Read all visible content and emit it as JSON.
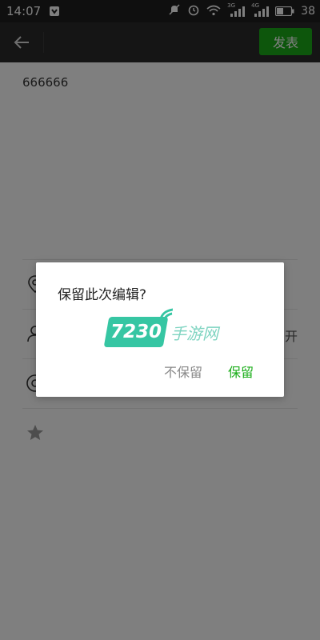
{
  "status_bar": {
    "time": "14:07",
    "network_3g": "3G",
    "network_4g": "4G",
    "battery_level": "38"
  },
  "header": {
    "publish_label": "发表"
  },
  "post": {
    "text": "666666"
  },
  "list": {
    "row_2_trailing": "开"
  },
  "dialog": {
    "title": "保留此次编辑?",
    "discard_label": "不保留",
    "keep_label": "保留"
  },
  "watermark": {
    "number": "7230",
    "text": "手游网"
  },
  "colors": {
    "accent": "#1aad19",
    "appbar": "#2b2b2b",
    "statusbar": "#1e1e1e"
  }
}
